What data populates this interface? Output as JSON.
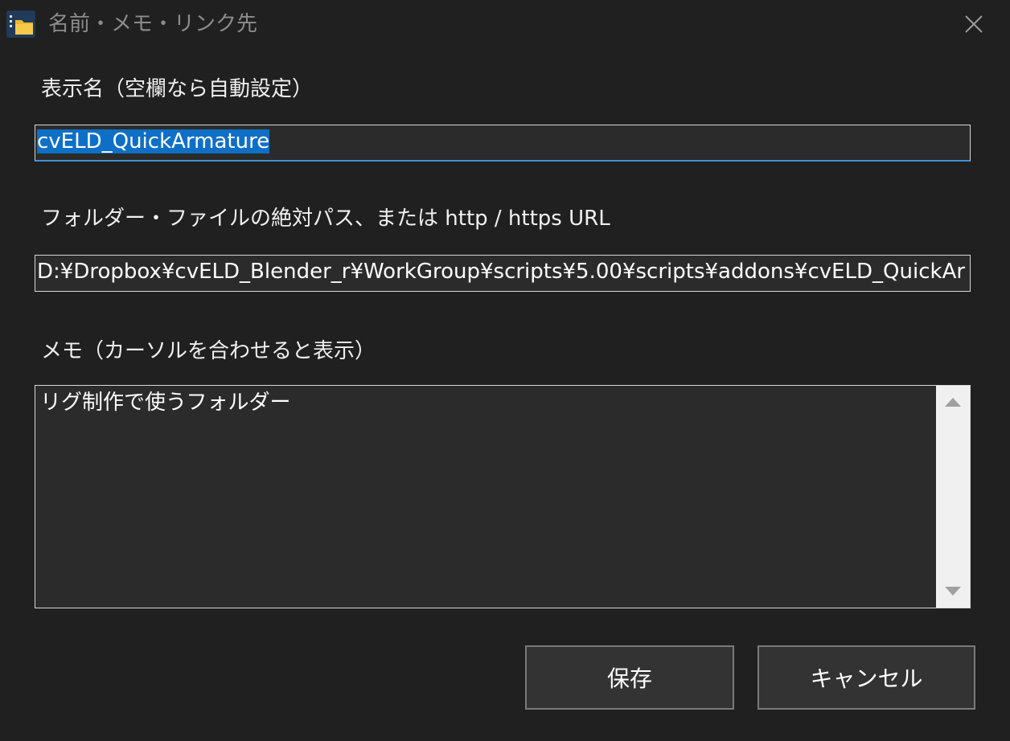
{
  "window": {
    "title": "名前・メモ・リンク先"
  },
  "fields": {
    "display_name_label": "表示名（空欄なら自動設定）",
    "display_name_value": "cvELD_QuickArmature",
    "path_label": "フォルダー・ファイルの絶対パス、または http / https URL",
    "path_value": "D:¥Dropbox¥cvELD_Blender_r¥WorkGroup¥scripts¥5.00¥scripts¥addons¥cvELD_QuickAr",
    "memo_label": "メモ（カーソルを合わせると表示）",
    "memo_value": "リグ制作で使うフォルダー"
  },
  "buttons": {
    "save_label": "保存",
    "cancel_label": "キャンセル"
  },
  "icons": {
    "app": "folder-app-icon",
    "close": "close-icon",
    "scroll_up": "scroll-up-arrow-icon",
    "scroll_down": "scroll-down-arrow-icon"
  },
  "colors": {
    "background": "#202020",
    "field_background": "#2b2b2b",
    "selection": "#0e6fc6",
    "focus_underline": "#3c8fd6",
    "title_text": "#8c8c8c"
  }
}
